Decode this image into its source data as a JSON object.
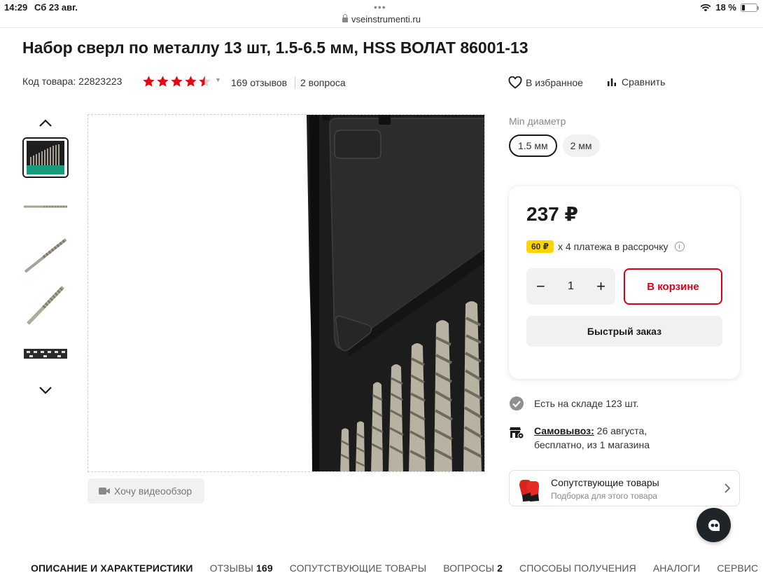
{
  "status_bar": {
    "time": "14:29",
    "date": "Сб 23 авг.",
    "url": "vseinstrumenti.ru",
    "battery": "18 %",
    "battery_level": 0.18
  },
  "product": {
    "title": "Набор сверл по металлу 13 шт, 1.5-6.5 мм, HSS ВОЛАТ 86001-13",
    "sku": "Код товара: 22823223",
    "rating": 4.5,
    "reviews": "169 отзывов",
    "questions": "2 вопроса",
    "favorite_label": "В избранное",
    "compare_label": "Сравнить"
  },
  "gallery": {
    "video_label": "Хочу видеообзор"
  },
  "options": {
    "label": "Min диаметр",
    "values": [
      "1.5 мм",
      "2 мм"
    ],
    "selected": "1.5 мм"
  },
  "price_card": {
    "price": "237 ₽",
    "installment_badge": "60 ₽",
    "installment_text": "x 4 платежа в рассрочку",
    "quantity": "1",
    "cart_label": "В корзине",
    "quick_order_label": "Быстрый заказ"
  },
  "availability": {
    "stock": "Есть на складе 123 шт.",
    "pickup_label": "Самовывоз:",
    "pickup_date": " 26 августа,",
    "pickup_details": "бесплатно, из 1 магазина"
  },
  "related": {
    "title": "Сопутствующие товары",
    "subtitle": "Подборка для этого товара"
  },
  "tabs": [
    {
      "label": "Описание и характеристики",
      "count": ""
    },
    {
      "label": "Отзывы",
      "count": "169"
    },
    {
      "label": "Сопутствующие товары",
      "count": ""
    },
    {
      "label": "Вопросы",
      "count": "2"
    },
    {
      "label": "Способы получения",
      "count": ""
    },
    {
      "label": "Аналоги",
      "count": ""
    },
    {
      "label": "Сервис",
      "count": ""
    }
  ],
  "colors": {
    "accent_red": "#d8001a",
    "star_red": "#e30613",
    "installment_yellow": "#ffd400"
  }
}
